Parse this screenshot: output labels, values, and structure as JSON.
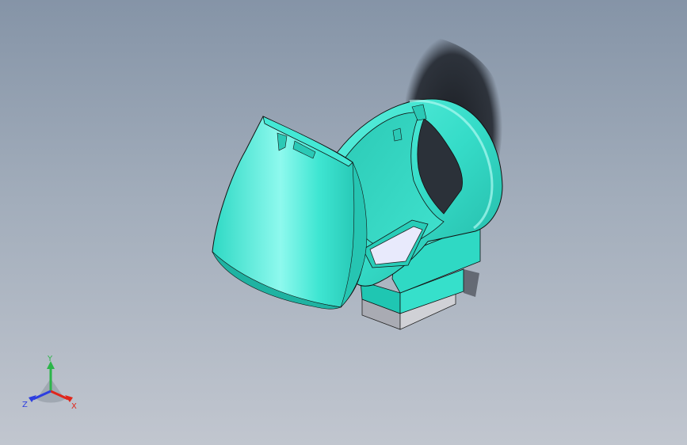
{
  "viewport": {
    "background_top": "#8594a7",
    "background_bottom": "#c1c6cf"
  },
  "model": {
    "body_color": "#33e0cc",
    "body_highlight": "#7df8ea",
    "body_shadow": "#1aa99a",
    "base_color": "#b9bac1",
    "window_color": "#e6e8fb"
  },
  "triad": {
    "x_label": "X",
    "y_label": "Y",
    "z_label": "Z",
    "x_color": "#e0261b",
    "y_color": "#2cb54a",
    "z_color": "#2d3ee0"
  }
}
